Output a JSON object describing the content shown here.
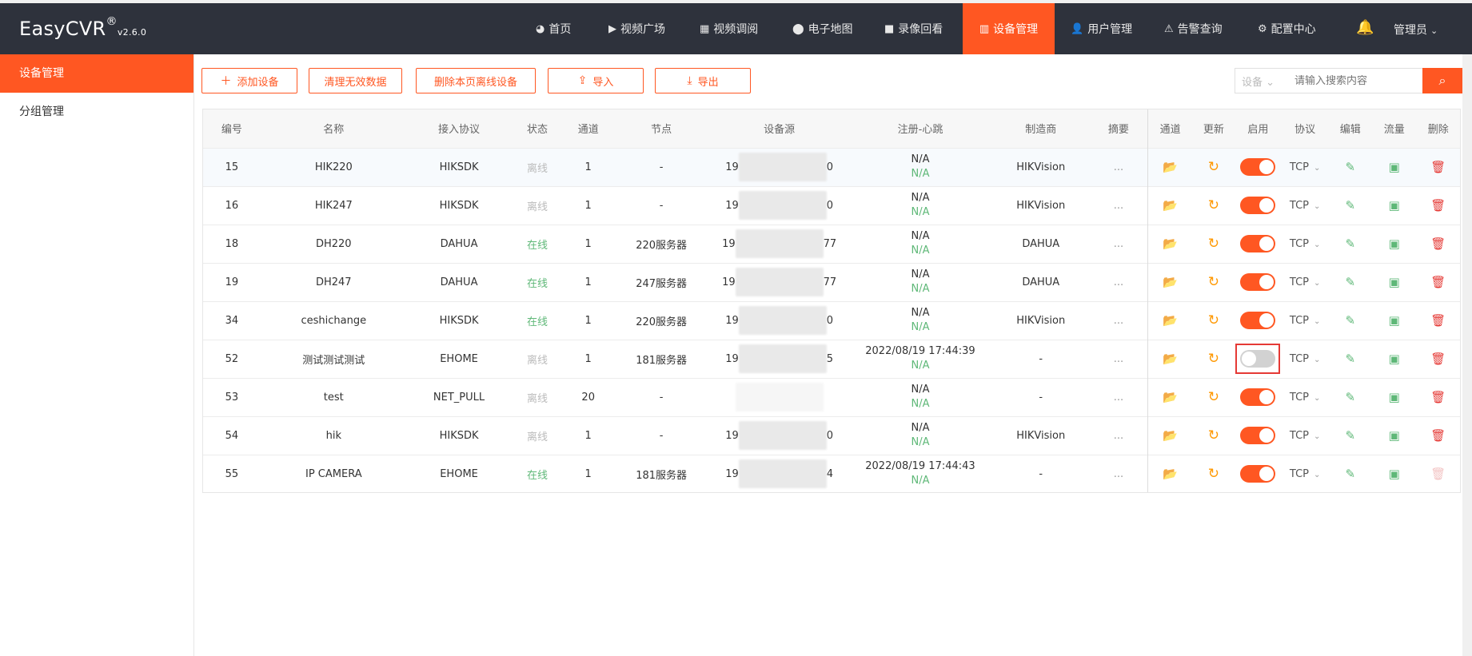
{
  "brand": {
    "name": "EasyCVR",
    "reg": "®",
    "version": "v2.6.0"
  },
  "nav": [
    {
      "icon": "dashboard-icon",
      "label": "首页"
    },
    {
      "icon": "play-circle-icon",
      "label": "视频广场"
    },
    {
      "icon": "grid-icon",
      "label": "视频调阅"
    },
    {
      "icon": "map-pin-icon",
      "label": "电子地图"
    },
    {
      "icon": "video-camera-icon",
      "label": "录像回看"
    },
    {
      "icon": "device-icon",
      "label": "设备管理",
      "active": true
    },
    {
      "icon": "user-icon",
      "label": "用户管理"
    },
    {
      "icon": "alarm-icon",
      "label": "告警查询"
    },
    {
      "icon": "gear-icon",
      "label": "配置中心"
    }
  ],
  "user": {
    "label": "管理员"
  },
  "sidebar": {
    "items": [
      {
        "label": "设备管理",
        "active": true
      },
      {
        "label": "分组管理"
      }
    ]
  },
  "toolbar": {
    "add": "添加设备",
    "clean": "清理无效数据",
    "delete_offline": "删除本页离线设备",
    "import": "导入",
    "export": "导出"
  },
  "search": {
    "select": "设备",
    "placeholder": "请输入搜索内容"
  },
  "table": {
    "headers": [
      "编号",
      "名称",
      "接入协议",
      "状态",
      "通道",
      "节点",
      "设备源",
      "注册-心跳",
      "制造商",
      "摘要",
      "通道",
      "更新",
      "启用",
      "协议",
      "编辑",
      "流量",
      "删除"
    ],
    "rows": [
      {
        "id": "15",
        "name": "HIK220",
        "protocol": "HIKSDK",
        "status": "离线",
        "online": false,
        "channels": "1",
        "node": "-",
        "src_pre": "19",
        "src_post": "0",
        "reg": "N/A",
        "hb": "N/A",
        "maker": "HIKVision",
        "summary": "...",
        "enabled": true,
        "proto": "TCP"
      },
      {
        "id": "16",
        "name": "HIK247",
        "protocol": "HIKSDK",
        "status": "离线",
        "online": false,
        "channels": "1",
        "node": "-",
        "src_pre": "19",
        "src_post": "0",
        "reg": "N/A",
        "hb": "N/A",
        "maker": "HIKVision",
        "summary": "...",
        "enabled": true,
        "proto": "TCP"
      },
      {
        "id": "18",
        "name": "DH220",
        "protocol": "DAHUA",
        "status": "在线",
        "online": true,
        "channels": "1",
        "node": "220服务器",
        "src_pre": "19",
        "src_post": "77",
        "reg": "N/A",
        "hb": "N/A",
        "maker": "DAHUA",
        "summary": "...",
        "enabled": true,
        "proto": "TCP"
      },
      {
        "id": "19",
        "name": "DH247",
        "protocol": "DAHUA",
        "status": "在线",
        "online": true,
        "channels": "1",
        "node": "247服务器",
        "src_pre": "19",
        "src_post": "77",
        "reg": "N/A",
        "hb": "N/A",
        "maker": "DAHUA",
        "summary": "...",
        "enabled": true,
        "proto": "TCP"
      },
      {
        "id": "34",
        "name": "ceshichange",
        "protocol": "HIKSDK",
        "status": "在线",
        "online": true,
        "channels": "1",
        "node": "220服务器",
        "src_pre": "19",
        "src_post": "0",
        "reg": "N/A",
        "hb": "N/A",
        "maker": "HIKVision",
        "summary": "...",
        "enabled": true,
        "proto": "TCP"
      },
      {
        "id": "52",
        "name": "测试测试测试",
        "protocol": "EHOME",
        "status": "离线",
        "online": false,
        "channels": "1",
        "node": "181服务器",
        "src_pre": "19",
        "src_post": "5",
        "reg": "2022/08/19 17:44:39",
        "hb": "N/A",
        "maker": "-",
        "summary": "...",
        "enabled": false,
        "proto": "TCP",
        "highlight": true
      },
      {
        "id": "53",
        "name": "test",
        "protocol": "NET_PULL",
        "status": "离线",
        "online": false,
        "channels": "20",
        "node": "-",
        "src_pre": "",
        "src_post": "",
        "reg": "N/A",
        "hb": "N/A",
        "maker": "-",
        "summary": "...",
        "enabled": true,
        "proto": "TCP"
      },
      {
        "id": "54",
        "name": "hik",
        "protocol": "HIKSDK",
        "status": "离线",
        "online": false,
        "channels": "1",
        "node": "-",
        "src_pre": "19",
        "src_post": "0",
        "reg": "N/A",
        "hb": "N/A",
        "maker": "HIKVision",
        "summary": "...",
        "enabled": true,
        "proto": "TCP"
      },
      {
        "id": "55",
        "name": "IP CAMERA",
        "protocol": "EHOME",
        "status": "在线",
        "online": true,
        "channels": "1",
        "node": "181服务器",
        "src_pre": "19",
        "src_post": "4",
        "reg": "2022/08/19 17:44:43",
        "hb": "N/A",
        "maker": "-",
        "summary": "...",
        "enabled": true,
        "proto": "TCP",
        "delete_disabled": true
      }
    ]
  },
  "colors": {
    "accent": "#ff5722",
    "topbar": "#2e323c",
    "online": "#5fb878",
    "offline": "#bbbbbb",
    "blue": "#1e9fff",
    "red": "#e53935",
    "highlight": "#e53935"
  }
}
